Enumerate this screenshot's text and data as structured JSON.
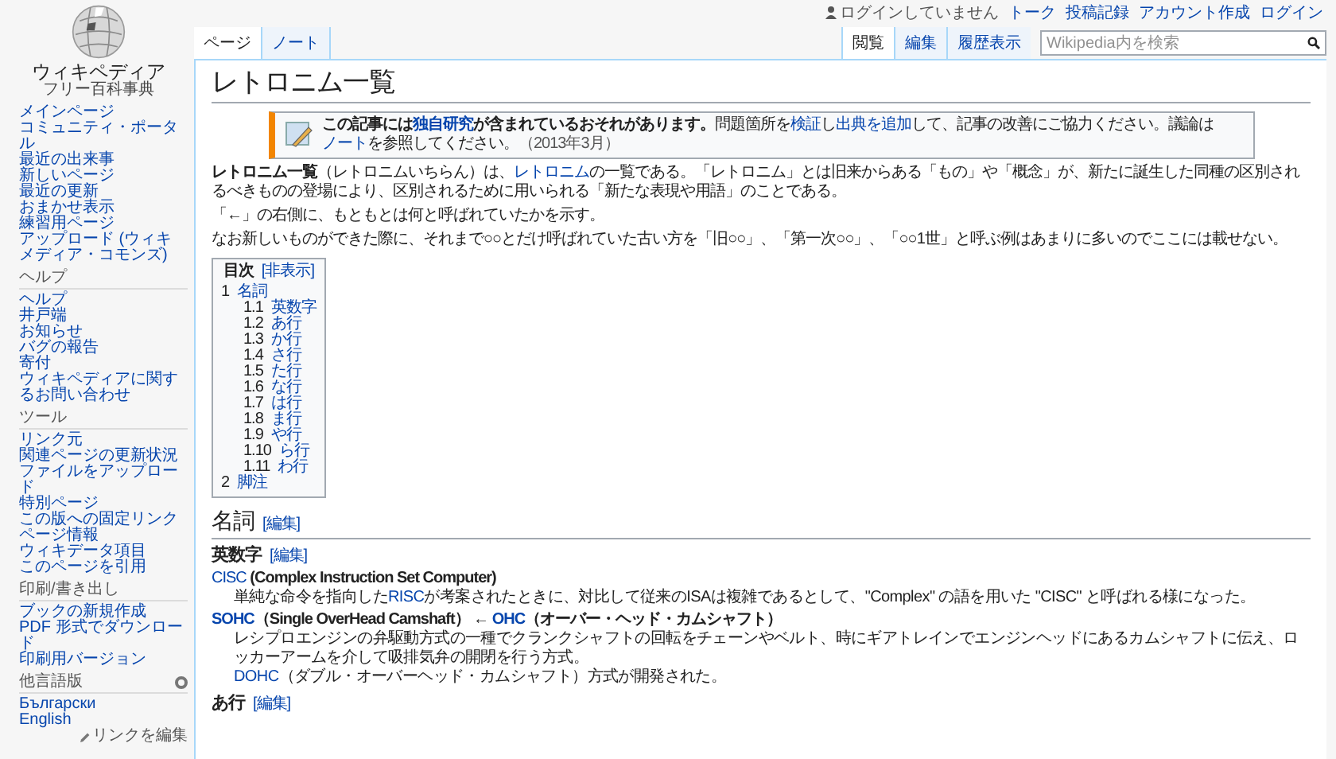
{
  "sidebar": {
    "logo": {
      "name": "ウィキペディア",
      "tagline": "フリー百科事典"
    },
    "navigation": [
      "メインページ",
      "コミュニティ・ポータル",
      "最近の出来事",
      "新しいページ",
      "最近の更新",
      "おまかせ表示",
      "練習用ページ",
      "アップロード (ウィキメディア・コモンズ)"
    ],
    "sections": [
      {
        "heading": "ヘルプ",
        "items": [
          "ヘルプ",
          "井戸端",
          "お知らせ",
          "バグの報告",
          "寄付",
          "ウィキペディアに関するお問い合わせ"
        ]
      },
      {
        "heading": "ツール",
        "items": [
          "リンク元",
          "関連ページの更新状況",
          "ファイルをアップロード",
          "特別ページ",
          "この版への固定リンク",
          "ページ情報",
          "ウィキデータ項目",
          "このページを引用"
        ]
      },
      {
        "heading": "印刷/書き出し",
        "items": [
          "ブックの新規作成",
          "PDF 形式でダウンロード",
          "印刷用バージョン"
        ]
      }
    ],
    "languages": {
      "heading": "他言語版",
      "items": [
        "Български",
        "English"
      ],
      "edit_link": "リンクを編集"
    }
  },
  "personal_tools": {
    "status": "ログインしていません",
    "links": [
      "トーク",
      "投稿記録",
      "アカウント作成",
      "ログイン"
    ]
  },
  "namespace_tabs": [
    {
      "label": "ページ",
      "selected": true
    },
    {
      "label": "ノート",
      "selected": false
    }
  ],
  "view_tabs": [
    {
      "label": "閲覧",
      "selected": true
    },
    {
      "label": "編集",
      "selected": false
    },
    {
      "label": "履歴表示",
      "selected": false
    }
  ],
  "search": {
    "placeholder": "Wikipedia内を検索"
  },
  "title": "レトロニム一覧",
  "notice": [
    {
      "kind": "bold",
      "text": "この記事には"
    },
    {
      "kind": "bold_link",
      "text": "独自研究"
    },
    {
      "kind": "bold",
      "text": "が含まれているおそれがあります。"
    },
    {
      "kind": "text",
      "text": "問題箇所を"
    },
    {
      "kind": "link",
      "text": "検証"
    },
    {
      "kind": "text",
      "text": "し"
    },
    {
      "kind": "link",
      "text": "出典を追加"
    },
    {
      "kind": "text",
      "text": "して、記事の改善にご協力ください。議論は"
    },
    {
      "kind": "link",
      "text": "ノート"
    },
    {
      "kind": "text",
      "text": "を参照してください。"
    },
    {
      "kind": "small",
      "text": "（2013年3月）"
    }
  ],
  "intro": [
    [
      {
        "kind": "bold",
        "text": "レトロニム一覧"
      },
      {
        "kind": "text",
        "text": "（レトロニムいちらん）は、"
      },
      {
        "kind": "link",
        "text": "レトロニム"
      },
      {
        "kind": "text",
        "text": "の一覧である。「レトロニム」とは旧来からある「もの」や「概念」が、新たに誕生した同種の区別されるべきものの登場により、区別されるために用いられる「新たな表現や用語」のことである。"
      }
    ],
    [
      {
        "kind": "text",
        "text": "「←」の右側に、もともとは何と呼ばれていたかを示す。"
      }
    ],
    [
      {
        "kind": "text",
        "text": "なお新しいものができた際に、それまで○○とだけ呼ばれていた古い方を「旧○○」、「第一次○○」、「○○1世」と呼ぶ例はあまりに多いのでここには載せない。"
      }
    ]
  ],
  "toc": {
    "title": "目次",
    "toggle": "[非表示]",
    "items": [
      {
        "number": "1",
        "label": "名詞",
        "children": [
          {
            "number": "1.1",
            "label": "英数字"
          },
          {
            "number": "1.2",
            "label": "あ行"
          },
          {
            "number": "1.3",
            "label": "か行"
          },
          {
            "number": "1.4",
            "label": "さ行"
          },
          {
            "number": "1.5",
            "label": "た行"
          },
          {
            "number": "1.6",
            "label": "な行"
          },
          {
            "number": "1.7",
            "label": "は行"
          },
          {
            "number": "1.8",
            "label": "ま行"
          },
          {
            "number": "1.9",
            "label": "や行"
          },
          {
            "number": "1.10",
            "label": "ら行"
          },
          {
            "number": "1.11",
            "label": "わ行"
          }
        ]
      },
      {
        "number": "2",
        "label": "脚注"
      }
    ]
  },
  "sections": [
    {
      "heading": "名詞",
      "edit": "[編集]",
      "subsections": [
        {
          "heading": "英数字",
          "edit": "[編集]",
          "entries": [
            {
              "term": [
                {
                  "kind": "link",
                  "text": "CISC"
                },
                {
                  "kind": "bold",
                  "text": " (Complex Instruction Set Computer)"
                }
              ],
              "descriptions": [
                [
                  {
                    "kind": "text",
                    "text": "単純な命令を指向した"
                  },
                  {
                    "kind": "link",
                    "text": "RISC"
                  },
                  {
                    "kind": "text",
                    "text": "が考案されたときに、対比して従来のISAは複雑であるとして、\"Complex\" の語を用いた \"CISC\" と呼ばれる様になった。"
                  }
                ]
              ]
            },
            {
              "term": [
                {
                  "kind": "bold_link",
                  "text": "SOHC"
                },
                {
                  "kind": "bold",
                  "text": "（Single OverHead Camshaft）"
                },
                {
                  "kind": "text",
                  "text": " ← "
                },
                {
                  "kind": "bold_link",
                  "text": "OHC"
                },
                {
                  "kind": "bold",
                  "text": "（オーバー・ヘッド・カムシャフト）"
                }
              ],
              "descriptions": [
                [
                  {
                    "kind": "text",
                    "text": "レシプロエンジンの弁駆動方式の一種でクランクシャフトの回転をチェーンやベルト、時にギアトレインでエンジンヘッドにあるカムシャフトに伝え、ロッカーアームを介して吸排気弁の開閉を行う方式。"
                  }
                ],
                [
                  {
                    "kind": "link",
                    "text": "DOHC"
                  },
                  {
                    "kind": "text",
                    "text": "（ダブル・オーバーヘッド・カムシャフト）方式が開発された。"
                  }
                ]
              ]
            }
          ]
        },
        {
          "heading": "あ行",
          "edit": "[編集]"
        }
      ]
    }
  ]
}
